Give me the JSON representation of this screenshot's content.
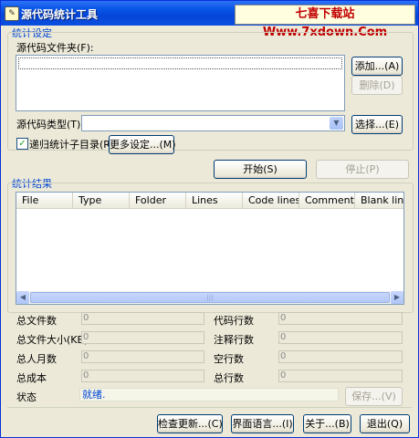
{
  "window": {
    "title": "源代码统计工具",
    "watermark": "七喜下载站 Www.7xdown.Com"
  },
  "settings": {
    "group_label": "统计设定",
    "folders_label": "源代码文件夹(F):",
    "add_button": "添加...(A)",
    "delete_button": "删除(D)",
    "type_label": "源代码类型(T):",
    "type_value": "",
    "select_button": "选择...(E)",
    "recursive_label": "递归统计子目录(R)",
    "recursive_checked": true,
    "more_button": "更多设定...(M)"
  },
  "actions": {
    "start_button": "开始(S)",
    "stop_button": "停止(P)"
  },
  "results": {
    "group_label": "统计结果",
    "columns": [
      "File",
      "Type",
      "Folder",
      "Lines",
      "Code lines",
      "Comment...",
      "Blank lines"
    ],
    "rows": []
  },
  "stats": {
    "total_files_label": "总文件数",
    "total_files": "0",
    "total_size_label": "总文件大小(KB)",
    "total_size": "0",
    "man_months_label": "总人月数",
    "man_months": "0",
    "total_cost_label": "总成本",
    "total_cost": "0",
    "code_lines_label": "代码行数",
    "code_lines": "0",
    "comment_lines_label": "注释行数",
    "comment_lines": "0",
    "blank_lines_label": "空行数",
    "blank_lines": "0",
    "total_lines_label": "总行数",
    "total_lines": "0"
  },
  "status": {
    "label": "状态",
    "value": "就绪.",
    "save_button": "保存...(V)"
  },
  "footer": {
    "update_button": "检查更新...(C)",
    "language_button": "界面语言...(I)",
    "about_button": "关于...(B)",
    "exit_button": "退出(Q)"
  }
}
